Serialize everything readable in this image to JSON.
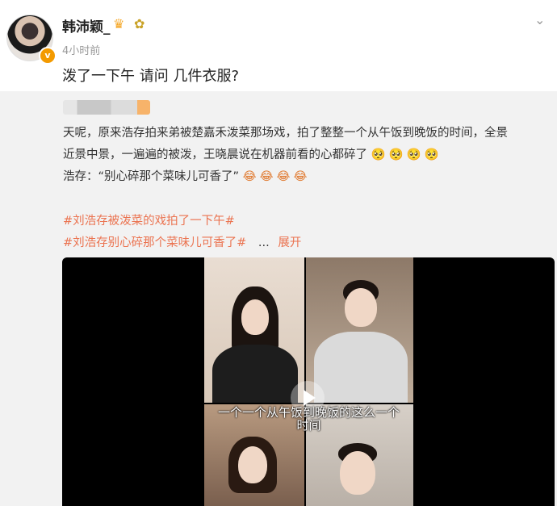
{
  "header": {
    "username": "韩沛颖_",
    "time": "4小时前",
    "icons": [
      "crown-icon",
      "flower-icon",
      "chevron-down-icon",
      "verified-badge-icon"
    ]
  },
  "post": {
    "text": "泼了一下午 请问 几件衣服?"
  },
  "repost": {
    "line1": "天呢，原来浩存拍来弟被楚嘉禾泼菜那场戏，拍了整整一个从午饭到晚饭的时间，全景",
    "line2": "近景中景，一遍遍的被泼，王晓晨说在机器前看的心都碎了",
    "line2_emojis": "🥺🥺🥺🥺",
    "line3": "浩存：“别心碎那个菜味儿可香了”",
    "line3_emojis": "😂😂😂😂",
    "hashtag1": "#刘浩存被泼菜的戏拍了一下午#",
    "hashtag2": "#刘浩存别心碎那个菜味儿可香了#",
    "ellipsis": "...",
    "expand": "展开"
  },
  "video": {
    "subtitle_line1": "一个一个从午饭到晚饭的这么一个",
    "subtitle_line2": "时间"
  },
  "colors": {
    "accent": "#eb7350",
    "verified": "#f39a00",
    "repost_bg": "#f2f2f2"
  }
}
